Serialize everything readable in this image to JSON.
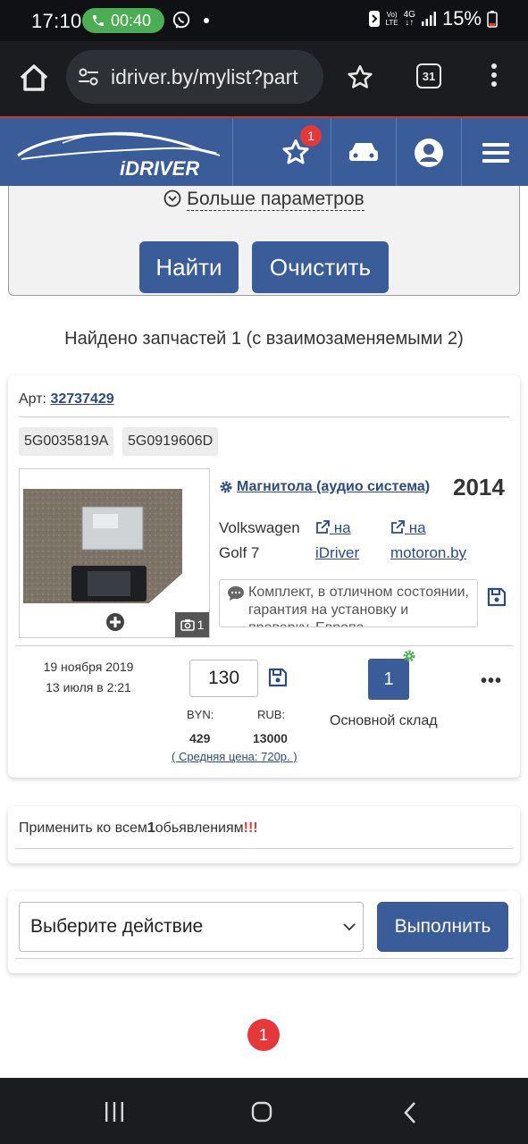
{
  "status_bar": {
    "time": "17:10",
    "call_timer": "00:40",
    "network_top": "Vo)",
    "network_bottom": "LTE",
    "net_type_top": "4G",
    "net_type_bottom": "↓↑",
    "battery": "15%"
  },
  "browser": {
    "url": "idriver.by/mylist?part",
    "tab_count": "31"
  },
  "site_header": {
    "logo_text": "iDRIVER",
    "favorites_badge": "1"
  },
  "filter": {
    "more_params": "Больше параметров",
    "find_label": "Найти",
    "clear_label": "Очистить"
  },
  "results": {
    "found_text": "Найдено запчастей 1 (с взаимозаменяемыми 2)"
  },
  "part": {
    "art_label": "Арт:",
    "art_number": "32737429",
    "codes": [
      "5G0035819A",
      "5G0919606D"
    ],
    "photo_count": "1",
    "name": "Магнитола (аудио система)",
    "year": "2014",
    "car_brand": "Volkswagen",
    "car_model": "Golf 7",
    "link_idriver_top": "на",
    "link_idriver_bottom": "iDriver",
    "link_motoron_top": "на",
    "link_motoron_bottom": "motoron.by",
    "comment": "Комплект, в отличном состоянии, гарантия на установку и проверку. Европа",
    "date_created": "19 ноября 2019",
    "date_updated": "13 июля в 2:21",
    "price": "130",
    "currency_byn_label": "BYN:",
    "currency_rub_label": "RUB:",
    "price_byn": "429",
    "price_rub": "13000",
    "avg_price": "( Средняя цена: 720р. )",
    "quantity": "1",
    "warehouse": "Основной склад",
    "more": "•••"
  },
  "apply_all": {
    "prefix": "Применить ко всем",
    "count": "1",
    "suffix": "обьявлениям",
    "marks": "!!!"
  },
  "bulk_action": {
    "select_value": "Выберите действие",
    "execute_label": "Выполнить"
  },
  "pagination": {
    "current_page": "1"
  },
  "colors": {
    "brand_blue": "#3a5c99",
    "link_blue": "#2b4a8a",
    "badge_red": "#e5383b",
    "settings_green": "#4caf50"
  }
}
